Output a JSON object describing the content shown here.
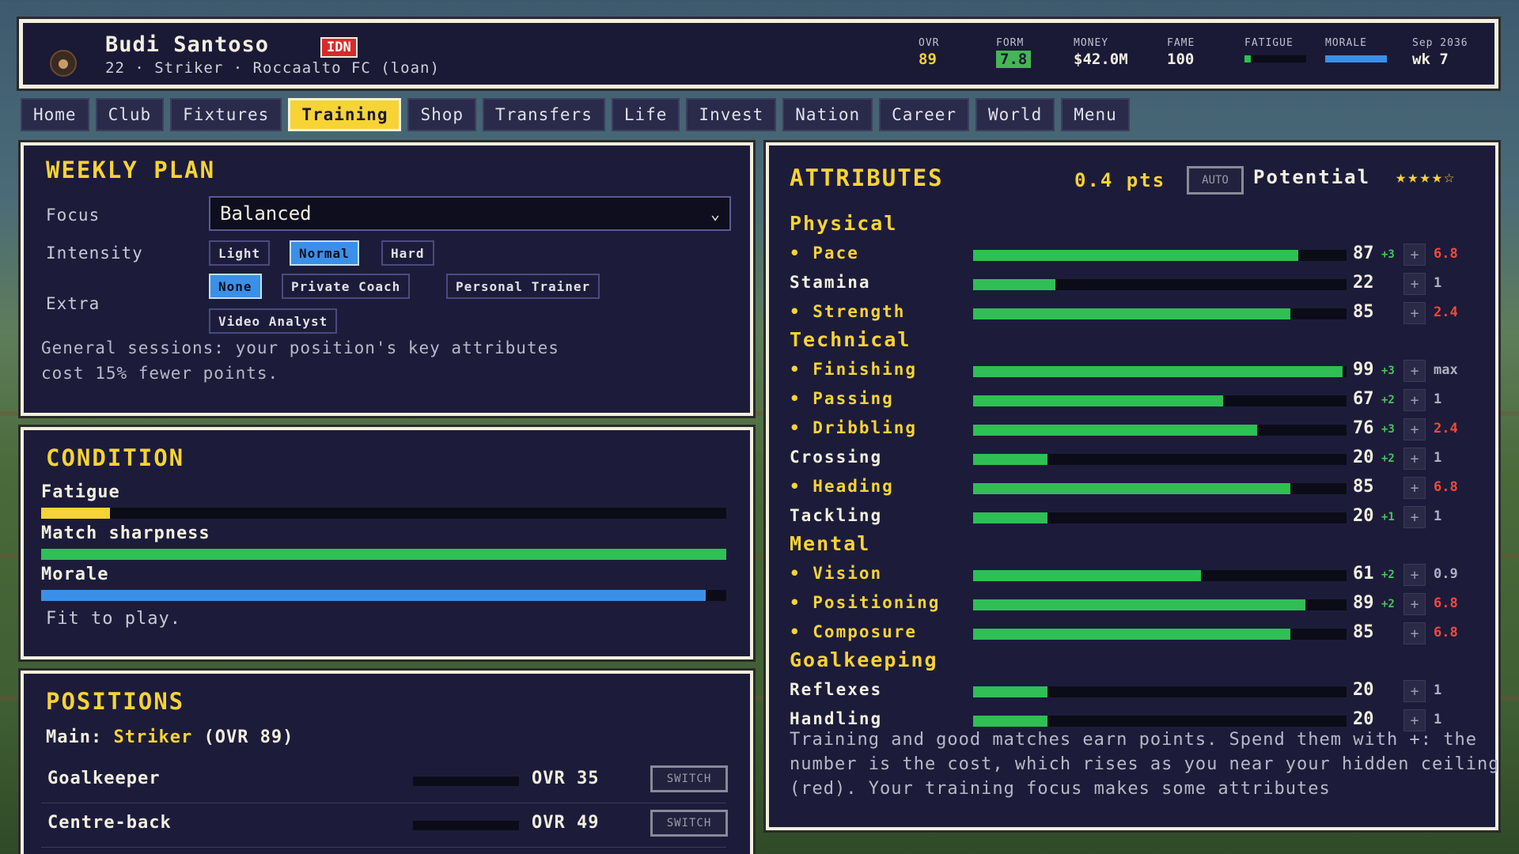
{
  "player": {
    "name": "Budi Santoso",
    "nation_code": "IDN",
    "subtitle": "22 · Striker · Roccaalto FC (loan)"
  },
  "stats": {
    "ovr_label": "OVR",
    "ovr": "89",
    "form_label": "FORM",
    "form": "7.8",
    "money_label": "MONEY",
    "money": "$42.0M",
    "fame_label": "FAME",
    "fame": "100",
    "fatigue_label": "FATIGUE",
    "fatigue_level": 0.1,
    "morale_label": "MORALE",
    "morale_level": 1.0,
    "date": "Sep 2036",
    "week": "wk 7"
  },
  "tabs": [
    "Home",
    "Club",
    "Fixtures",
    "Training",
    "Shop",
    "Transfers",
    "Life",
    "Invest",
    "Nation",
    "Career",
    "World",
    "Menu"
  ],
  "active_tab": "Training",
  "weekly_plan": {
    "title": "WEEKLY PLAN",
    "focus_label": "Focus",
    "focus_value": "Balanced",
    "intensity_label": "Intensity",
    "intensity_options": [
      "Light",
      "Normal",
      "Hard"
    ],
    "intensity_selected": "Normal",
    "extra_label": "Extra",
    "extra_options": [
      "None",
      "Private Coach",
      "Personal Trainer",
      "Video Analyst"
    ],
    "extra_selected": "None",
    "note": "General sessions: your position's key attributes cost 15% fewer points."
  },
  "condition": {
    "title": "CONDITION",
    "fatigue_label": "Fatigue",
    "fatigue": 0.1,
    "sharpness_label": "Match sharpness",
    "sharpness": 1.0,
    "morale_label": "Morale",
    "morale": 0.97,
    "status": "Fit to play."
  },
  "positions": {
    "title": "POSITIONS",
    "main_prefix": "Main:",
    "main_position": "Striker",
    "main_ovr": "(OVR 89)",
    "rows": [
      {
        "name": "Goalkeeper",
        "ovr": "OVR 35",
        "button": "SWITCH"
      },
      {
        "name": "Centre-back",
        "ovr": "OVR 49",
        "button": "SWITCH"
      }
    ]
  },
  "attributes": {
    "title": "ATTRIBUTES",
    "points": "0.4 pts",
    "auto_label": "AUTO",
    "potential_label": "Potential",
    "potential_stars": "★★★★☆",
    "categories": [
      {
        "name": "Physical",
        "attrs": [
          {
            "name": "Pace",
            "key": true,
            "value": 87,
            "delta": "+3",
            "cost": "6.8",
            "cost_color": "red"
          },
          {
            "name": "Stamina",
            "key": false,
            "value": 22,
            "delta": "",
            "cost": "1",
            "cost_color": "grey"
          },
          {
            "name": "Strength",
            "key": true,
            "value": 85,
            "delta": "",
            "cost": "2.4",
            "cost_color": "red"
          }
        ]
      },
      {
        "name": "Technical",
        "attrs": [
          {
            "name": "Finishing",
            "key": true,
            "value": 99,
            "delta": "+3",
            "cost": "max",
            "cost_color": "grey"
          },
          {
            "name": "Passing",
            "key": true,
            "value": 67,
            "delta": "+2",
            "cost": "1",
            "cost_color": "grey"
          },
          {
            "name": "Dribbling",
            "key": true,
            "value": 76,
            "delta": "+3",
            "cost": "2.4",
            "cost_color": "red"
          },
          {
            "name": "Crossing",
            "key": false,
            "value": 20,
            "delta": "+2",
            "cost": "1",
            "cost_color": "grey"
          },
          {
            "name": "Heading",
            "key": true,
            "value": 85,
            "delta": "",
            "cost": "6.8",
            "cost_color": "red"
          },
          {
            "name": "Tackling",
            "key": false,
            "value": 20,
            "delta": "+1",
            "cost": "1",
            "cost_color": "grey"
          }
        ]
      },
      {
        "name": "Mental",
        "attrs": [
          {
            "name": "Vision",
            "key": true,
            "value": 61,
            "delta": "+2",
            "cost": "0.9",
            "cost_color": "grey"
          },
          {
            "name": "Positioning",
            "key": true,
            "value": 89,
            "delta": "+2",
            "cost": "6.8",
            "cost_color": "red"
          },
          {
            "name": "Composure",
            "key": true,
            "value": 85,
            "delta": "",
            "cost": "6.8",
            "cost_color": "red"
          }
        ]
      },
      {
        "name": "Goalkeeping",
        "attrs": [
          {
            "name": "Reflexes",
            "key": false,
            "value": 20,
            "delta": "",
            "cost": "1",
            "cost_color": "grey"
          },
          {
            "name": "Handling",
            "key": false,
            "value": 20,
            "delta": "",
            "cost": "1",
            "cost_color": "grey"
          }
        ]
      }
    ],
    "note": "Training and good matches earn points. Spend them with +: the number is the cost, which rises as you near your hidden ceiling (red). Your training focus makes some attributes"
  },
  "colors": {
    "accent_yellow": "#f7d335",
    "bar_green": "#2fbf55",
    "bar_blue": "#3a90e8",
    "cost_red": "#f04a3a",
    "panel_bg": "#1c1c3a"
  }
}
